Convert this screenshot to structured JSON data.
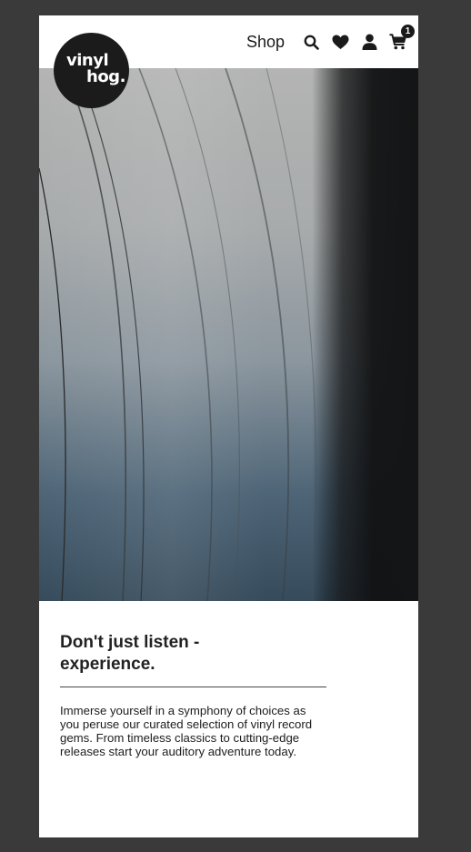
{
  "brand": {
    "logo_line1": "vinyl",
    "logo_line2": "hog."
  },
  "nav": {
    "shop_label": "Shop",
    "icons": [
      "search-icon",
      "heart-icon",
      "user-icon",
      "cart-icon"
    ],
    "cart_count": "1"
  },
  "hero": {
    "image": "close-up of a vinyl record grooves"
  },
  "content": {
    "headline": "Don't just listen - experience.",
    "body": "Immerse yourself in a symphony of choices as you peruse our curated selection of vinyl record gems. From timeless classics to cutting-edge releases start your auditory adventure today."
  },
  "colors": {
    "background": "#3a3a3a",
    "page": "#ffffff",
    "logo_bg": "#1c1b1c",
    "text": "#222222"
  }
}
